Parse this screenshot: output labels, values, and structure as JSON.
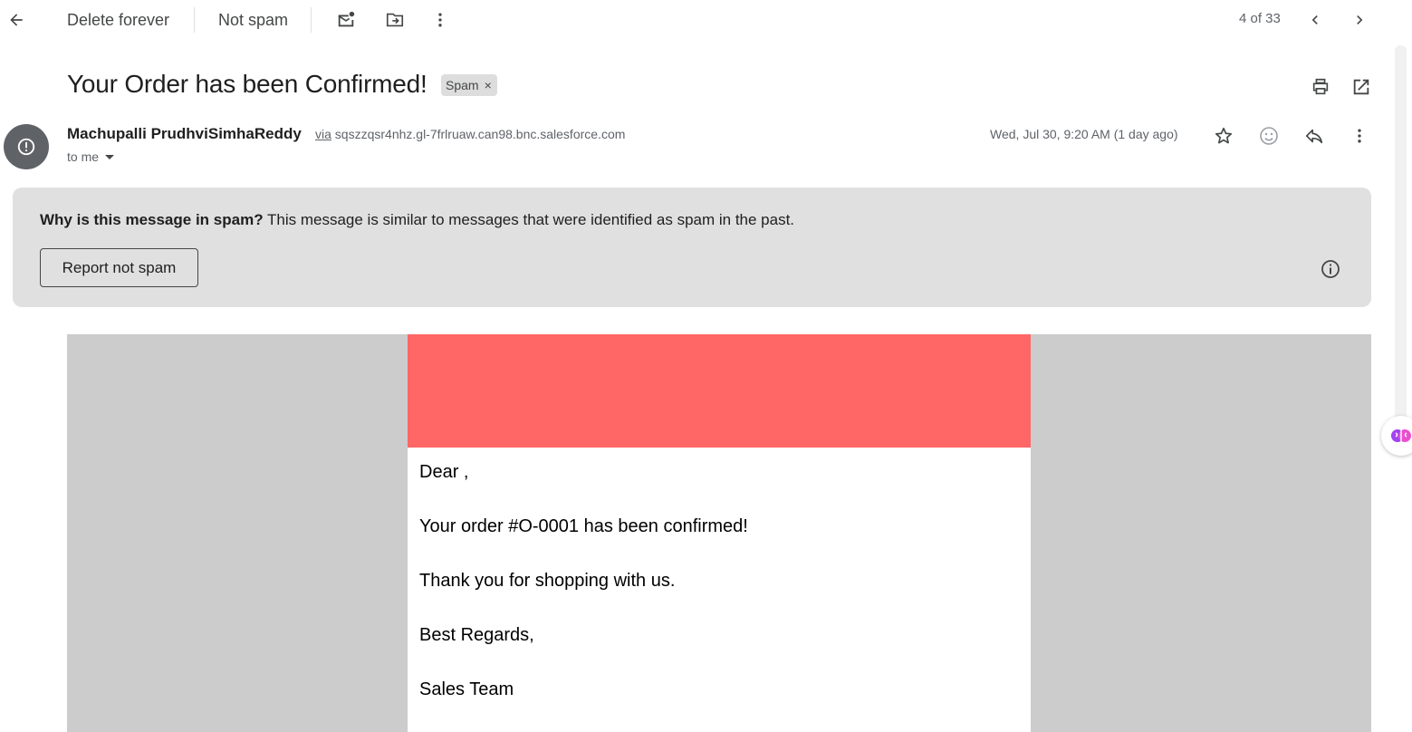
{
  "toolbar": {
    "delete_forever": "Delete forever",
    "not_spam": "Not spam",
    "counter": "4 of 33"
  },
  "message": {
    "subject": "Your Order has been Confirmed!",
    "label": "Spam",
    "label_remove": "×",
    "sender_name": "Machupalli PrudhviSimhaReddy",
    "via_word": "via",
    "via_domain": "sqszzqsr4nhz.gl-7frlruaw.can98.bnc.salesforce.com",
    "to": "to me",
    "date": "Wed, Jul 30, 9:20 AM (1 day ago)"
  },
  "spam_banner": {
    "question": "Why is this message in spam?",
    "explanation": "This message is similar to messages that were identified as spam in the past.",
    "report_button": "Report not spam"
  },
  "email_body": {
    "header_color": "#ff6666",
    "lines": [
      "Dear ,",
      "Your order #O-0001 has been confirmed!",
      "Thank you for shopping with us.",
      "Best Regards,",
      "Sales Team"
    ]
  },
  "icons": {
    "back": "arrow-left-icon",
    "mark_unread": "mark-unread-icon",
    "move_to": "move-to-folder-icon",
    "more": "more-vert-icon",
    "prev": "chevron-left-icon",
    "next": "chevron-right-icon",
    "print": "print-icon",
    "open_new": "open-in-new-window-icon",
    "star": "star-icon",
    "emoji": "emoji-reaction-icon",
    "reply": "reply-icon",
    "warning": "spam-warning-icon",
    "info": "info-icon"
  }
}
